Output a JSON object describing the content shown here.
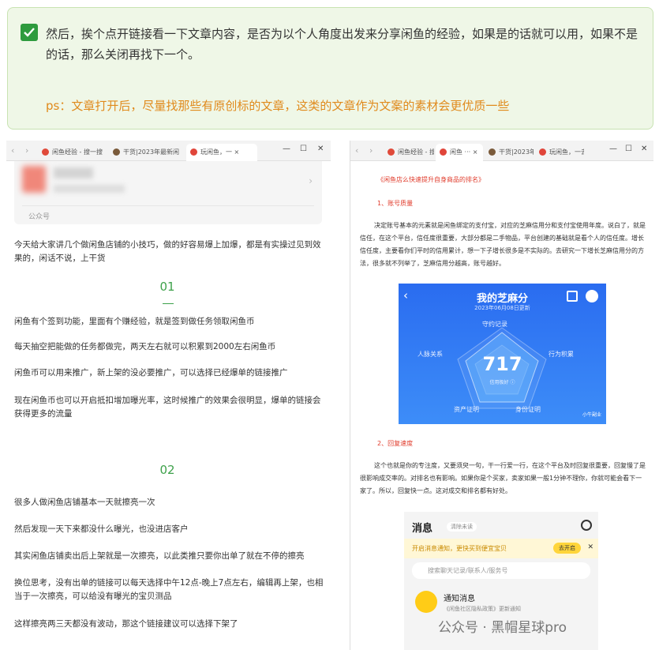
{
  "tip": {
    "line1": "然后，挨个点开链接看一下文章内容，是否为以个人角度出发来分享闲鱼的经验，如果是的话就可以用，如果不是的话，那么关闭再找下一个。",
    "ps": "ps：文章打开后，尽量找那些有原创标的文章，这类的文章作为文案的素材会更优质一些"
  },
  "left": {
    "tabs": [
      "闲鱼经验 - 搜一搜",
      "干货|2023年最新闲",
      "玩闲鱼，一"
    ],
    "card_source": "公众号",
    "intro": "今天给大家讲几个做闲鱼店铺的小技巧，做的好容易爆上加爆，都是有实操过见到效果的，闲话不说，上干货",
    "sec1": "01",
    "p1": "闲鱼有个签到功能，里面有个赚经验，就是签到做任务领取闲鱼币",
    "p2": "每天抽空把能做的任务都做完，两天左右就可以积累到2000左右闲鱼币",
    "p3": "闲鱼币可以用来推广，新上架的没必要推广，可以选择已经爆单的链接推广",
    "p4": "现在闲鱼币也可以开启抵扣增加曝光率，这时候推广的效果会很明显，爆单的链接会获得更多的流量",
    "sec2": "02",
    "p5": "很多人做闲鱼店铺基本一天就擦亮一次",
    "p6": "然后发现一天下来都没什么曝光，也没进店客户",
    "p7": "其实闲鱼店铺卖出后上架就是一次擦亮，以此类推只要你出单了就在不停的擦亮",
    "p8": "换位思考，没有出单的链接可以每天选择中午12点-晚上7点左右，编辑再上架，也相当于一次擦亮，可以给没有曝光的宝贝测品",
    "p9": "这样擦亮两三天都没有波动，那这个链接建议可以选择下架了"
  },
  "right": {
    "tabs": [
      "闲鱼经验 - 搜",
      "闲鱼",
      "干货|2023年",
      "玩闲鱼，一去"
    ],
    "heading": "《闲鱼店么快速提升自身商品的排名》",
    "h1": "1、账号质量",
    "p1": "决定账号基本的元素就是闲鱼绑定的支付宝，对应的芝麻信用分和支付宝使用年度。说白了，就是信任，在这个平台，信任度很重要，大部分都是二手物品，平台创建的基础就是看个人的信任度。增长信任度，主要看你们平时的信用累计，想一下子增长很多是不实际的。去研究一下增长芝麻信用分的方法，很多就不列举了，芝麻信用分越高，账号越好。",
    "zhima": {
      "title": "我的芝麻分",
      "date": "2023年06月08日更新",
      "label_top": "守约记录",
      "label_left": "人脉关系",
      "label_right": "行为积累",
      "label_bl": "资产证明",
      "label_br": "身份证明",
      "score": "717",
      "grade": "信用极好 ⓘ",
      "watermark": "小牛副业"
    },
    "h2": "2、回复速度",
    "p2": "这个也就是你的专注度，又要须臾一句，干一行爱一行，在这个平台及时回复很重要，回复慢了是很影响成交率的。对排名也有影响。如果你是个买家，卖家如果一般1分钟不理你，你就可能会看下一家了。所以，回复快一点。这对成交和排名都有好处。",
    "msg": {
      "title": "消息",
      "clear": "清除未读",
      "notice": "开启消息通知，更快买到便宜宝贝",
      "open": "去开启",
      "search": "搜索聊天记录/联系人/服务号",
      "item_title": "通知消息",
      "item_sub": "《闲鱼社区隐私政策》更新通知"
    }
  },
  "watermark": "公众号 · 黑帽星球pro"
}
